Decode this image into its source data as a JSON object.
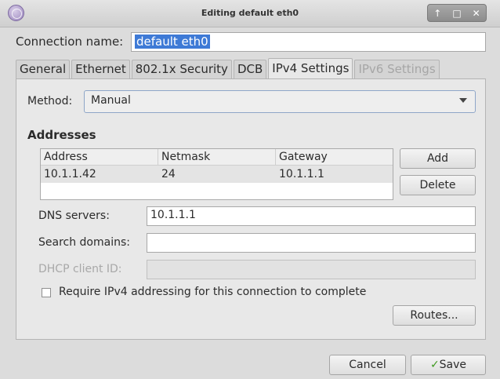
{
  "window": {
    "title": "Editing default eth0",
    "controls": [
      "↑",
      "□",
      "✕"
    ]
  },
  "connection": {
    "label": "Connection name:",
    "value": "default eth0"
  },
  "tabs": [
    {
      "label": "General",
      "state": "normal"
    },
    {
      "label": "Ethernet",
      "state": "normal"
    },
    {
      "label": "802.1x Security",
      "state": "normal"
    },
    {
      "label": "DCB",
      "state": "normal"
    },
    {
      "label": "IPv4 Settings",
      "state": "active"
    },
    {
      "label": "IPv6 Settings",
      "state": "disabled"
    }
  ],
  "ipv4": {
    "method_label": "Method:",
    "method_value": "Manual",
    "addresses_heading": "Addresses",
    "table": {
      "headers": [
        "Address",
        "Netmask",
        "Gateway"
      ],
      "rows": [
        [
          "10.1.1.42",
          "24",
          "10.1.1.1"
        ]
      ]
    },
    "add_label": "Add",
    "delete_label": "Delete",
    "dns_label": "DNS servers:",
    "dns_value": "10.1.1.1",
    "search_label": "Search domains:",
    "search_value": "",
    "dhcp_label": "DHCP client ID:",
    "dhcp_value": "",
    "require_label": "Require IPv4 addressing for this connection to complete",
    "require_checked": false,
    "routes_label": "Routes..."
  },
  "footer": {
    "cancel_label": "Cancel",
    "save_label": "Save"
  },
  "colors": {
    "selection": "#3e7ad6",
    "save_icon": "#3f9a20"
  }
}
